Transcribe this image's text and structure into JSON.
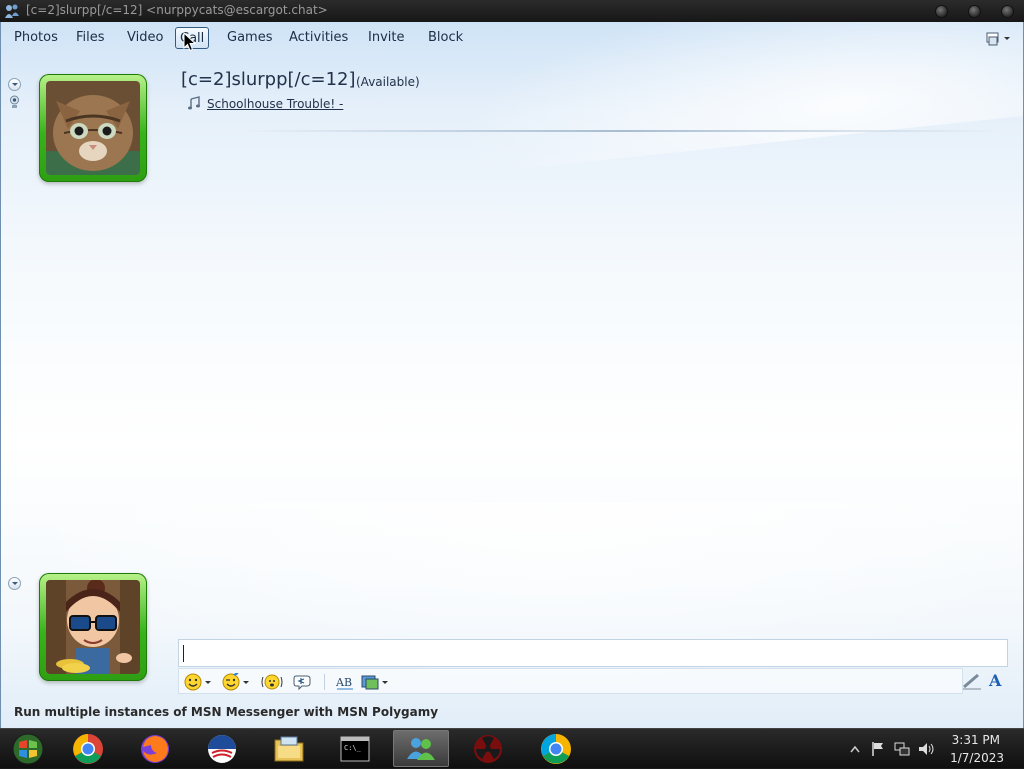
{
  "window": {
    "title": "[c=2]slurpp[/c=12] <nurppycats@escargot.chat>"
  },
  "menu": {
    "items": [
      "Photos",
      "Files",
      "Video",
      "Call",
      "Games",
      "Activities",
      "Invite",
      "Block"
    ],
    "active": "Call"
  },
  "contact": {
    "name": "[c=2]slurpp[/c=12]",
    "status": "(Available)",
    "personal_message": "Schoolhouse Trouble! -"
  },
  "compose": {
    "value": "",
    "toolbar": [
      "emoticon-icon",
      "wink-icon",
      "nudge-icon",
      "voice-clip-icon",
      "spellcheck-icon",
      "background-icon"
    ]
  },
  "ad": {
    "text": "Run multiple instances of MSN Messenger with MSN Polygamy"
  },
  "taskbar": {
    "apps": [
      "start-orb-icon",
      "chrome-icon",
      "firefox-icon",
      "obama-logo-icon",
      "file-explorer-icon",
      "command-prompt-icon",
      "msn-messenger-icon",
      "radioactive-icon",
      "chrome-alt-icon"
    ],
    "active_app": "msn-messenger-icon"
  },
  "clock": {
    "time": "3:31 PM",
    "date": "1/7/2023"
  },
  "colors": {
    "window_bg_top": "#cfe3f6",
    "frame_green": "#37b31a",
    "text": "#22324a"
  }
}
